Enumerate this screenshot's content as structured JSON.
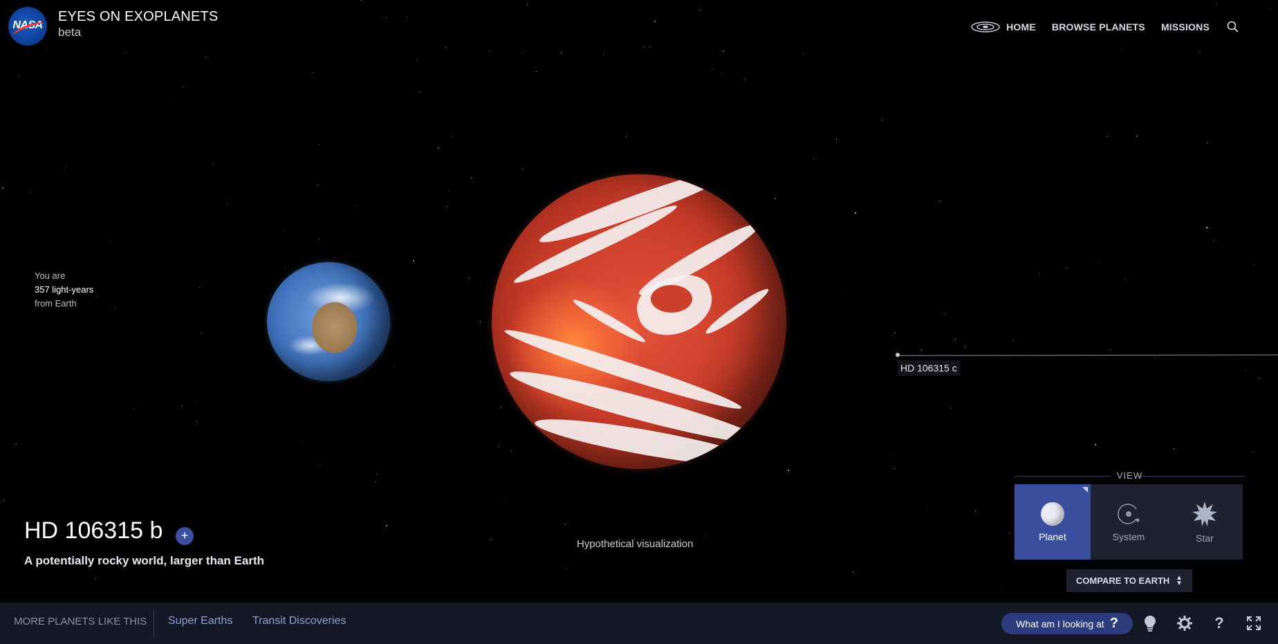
{
  "header": {
    "logo_text": "NASA",
    "app_title": "EYES ON EXOPLANETS",
    "app_subtitle": "beta"
  },
  "nav": {
    "items": [
      {
        "label": "HOME",
        "icon": "galaxy-icon"
      },
      {
        "label": "BROWSE PLANETS"
      },
      {
        "label": "MISSIONS"
      }
    ],
    "search_icon": "search-icon"
  },
  "distance": {
    "line1": "You are",
    "line2": "357 light-years",
    "line3": "from Earth"
  },
  "scene": {
    "orbit_label": "HD 106315 c",
    "caption": "Hypothetical visualization"
  },
  "planet": {
    "name": "HD 106315 b",
    "add_label": "+",
    "description": "A potentially rocky world, larger than Earth"
  },
  "view": {
    "heading": "VIEW",
    "options": [
      {
        "label": "Planet",
        "icon": "planet-icon",
        "active": true
      },
      {
        "label": "System",
        "icon": "system-icon",
        "active": false
      },
      {
        "label": "Star",
        "icon": "star-icon",
        "active": false
      }
    ],
    "compare_label": "COMPARE TO EARTH"
  },
  "bottom_bar": {
    "more_label": "MORE PLANETS LIKE THIS",
    "links": [
      "Super Earths",
      "Transit Discoveries"
    ],
    "looking_label": "What am I looking at",
    "looking_glyph": "?",
    "icons": [
      "lightbulb-icon",
      "gear-icon",
      "help-icon",
      "fullscreen-icon"
    ]
  },
  "colors": {
    "background": "#000000",
    "accent": "#3b4e9e",
    "bar": "#141724",
    "link": "#8fa0d4"
  }
}
